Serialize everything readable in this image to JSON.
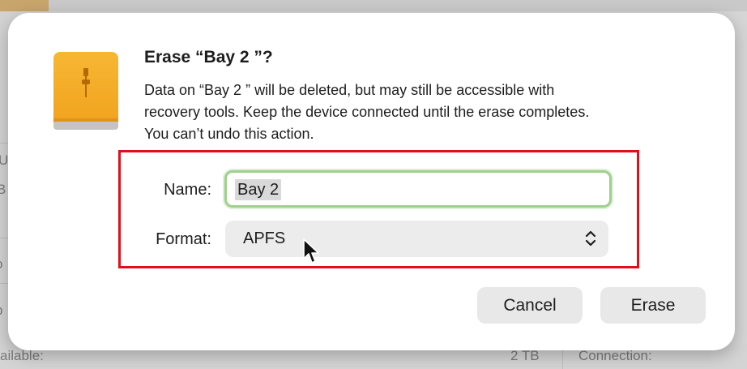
{
  "background": {
    "fragments": {
      "left_u": "Us",
      "left_b": "B",
      "left_o": "o",
      "left_p": "p",
      "bottom_available": "ailable:",
      "bottom_size": "2 TB",
      "bottom_connection": "Connection:"
    }
  },
  "dialog": {
    "title": "Erase “Bay 2 ”?",
    "message_lines": [
      "Data on “Bay 2 ” will be deleted, but may still be accessible with",
      "recovery tools. Keep the device connected until the erase completes.",
      "You can’t undo this action."
    ],
    "name_label": "Name:",
    "name_value": "Bay 2",
    "format_label": "Format:",
    "format_value": "APFS",
    "cancel_label": "Cancel",
    "erase_label": "Erase",
    "icons": {
      "drive": "external-drive-icon",
      "chevron": "chevron-up-down-icon",
      "cursor": "mouse-pointer-icon"
    }
  },
  "colors": {
    "drive_orange": "#f5a623",
    "highlight_red": "#e0101b",
    "focus_green": "#9fd08d"
  }
}
